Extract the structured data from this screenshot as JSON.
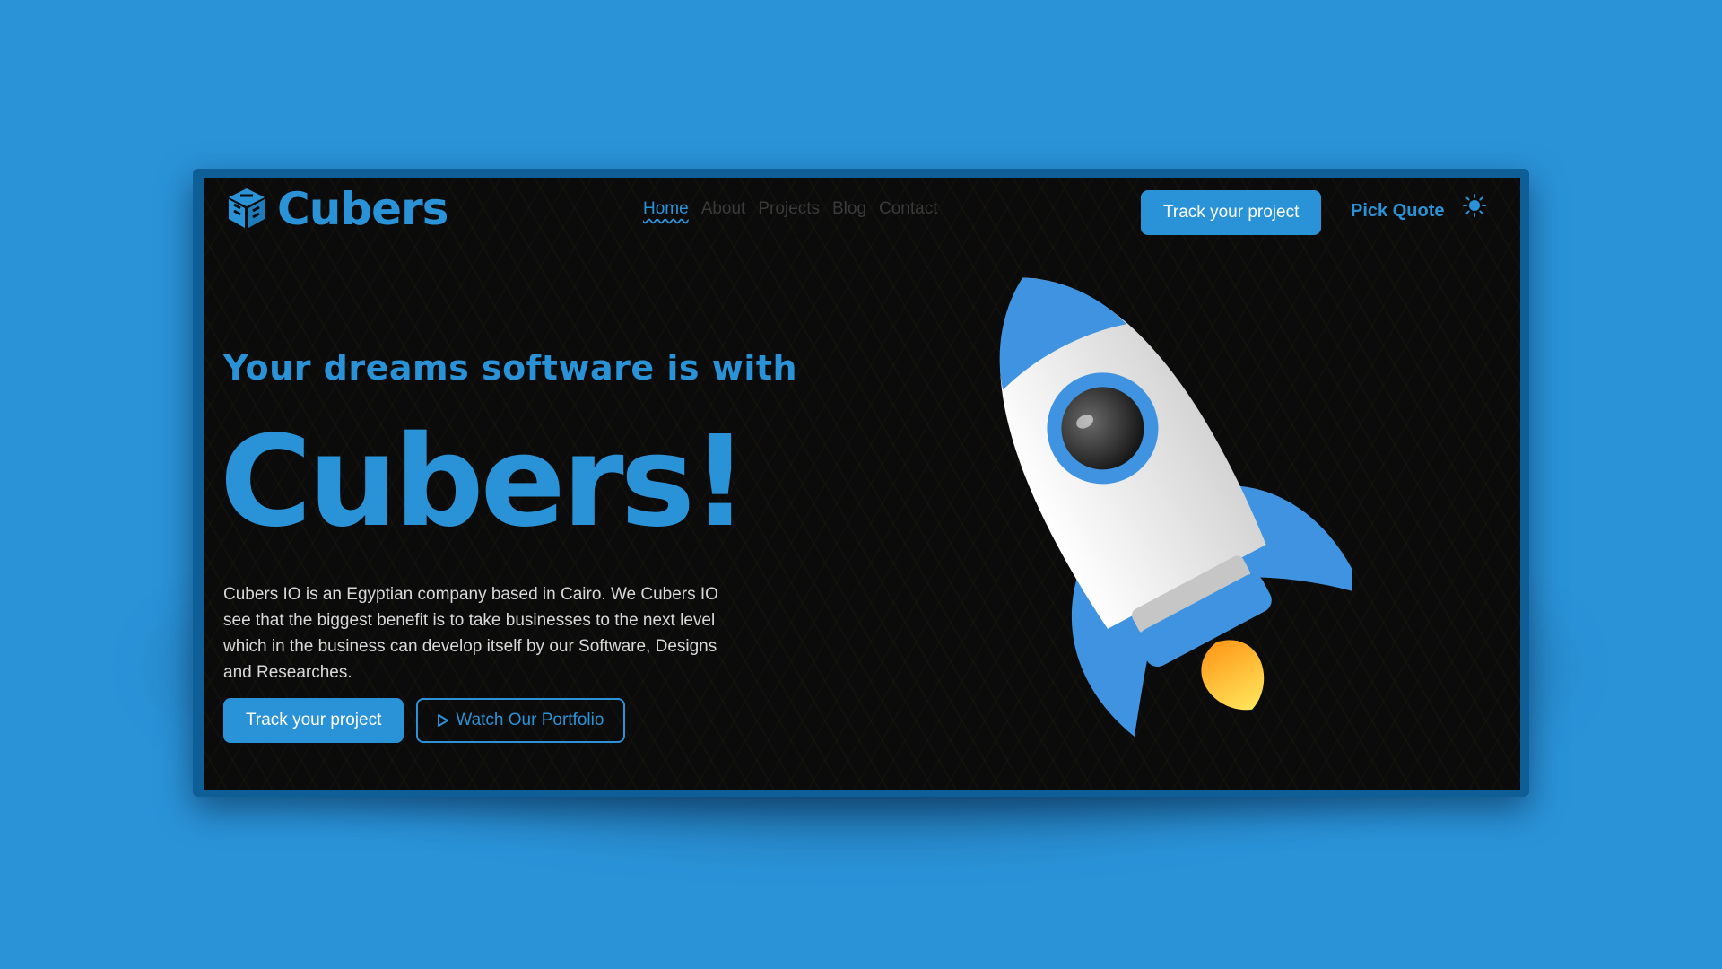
{
  "brand": {
    "name": "Cubers",
    "accent": "#2a93d8"
  },
  "nav": {
    "items": [
      {
        "label": "Home",
        "active": true
      },
      {
        "label": "About"
      },
      {
        "label": "Projects"
      },
      {
        "label": "Blog"
      },
      {
        "label": "Contact"
      }
    ]
  },
  "header": {
    "track_button": "Track your project",
    "pick_quote": "Pick Quote",
    "theme_icon": "sun-icon"
  },
  "hero": {
    "subtitle": "Your dreams software is with",
    "title": "Cubers!",
    "description": "Cubers IO is an Egyptian company based in Cairo. We Cubers IO see that the biggest benefit is to take businesses to the next level which in the business can develop itself by our Software, Designs and Researches.",
    "primary_button": "Track your project",
    "secondary_button": "Watch Our Portfolio",
    "secondary_icon": "play-icon",
    "illustration": "rocket-illustration"
  }
}
